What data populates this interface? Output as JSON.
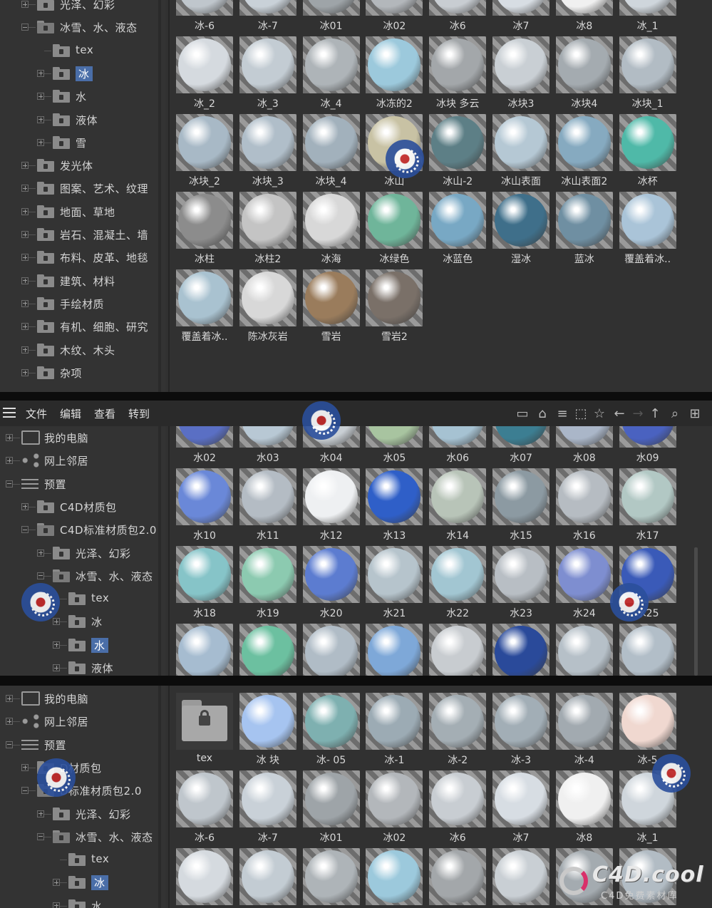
{
  "panel1": {
    "tree": [
      {
        "label": "光泽、幻彩",
        "icon": "folder-icon"
      },
      {
        "label": "冰雪、水、液态",
        "icon": "folder-open-icon"
      },
      {
        "label": "tex",
        "icon": "folder-icon"
      },
      {
        "label": "冰",
        "icon": "folder-icon",
        "selected": true
      },
      {
        "label": "水",
        "icon": "folder-icon"
      },
      {
        "label": "液体",
        "icon": "folder-icon"
      },
      {
        "label": "雪",
        "icon": "folder-icon"
      },
      {
        "label": "发光体",
        "icon": "folder-icon"
      },
      {
        "label": "图案、艺术、纹理",
        "icon": "folder-icon"
      },
      {
        "label": "地面、草地",
        "icon": "folder-icon"
      },
      {
        "label": "岩石、混凝土、墙",
        "icon": "folder-icon"
      },
      {
        "label": "布料、皮革、地毯",
        "icon": "folder-icon"
      },
      {
        "label": "建筑、材料",
        "icon": "folder-icon"
      },
      {
        "label": "手绘材质",
        "icon": "folder-icon"
      },
      {
        "label": "有机、细胞、研究",
        "icon": "folder-icon"
      },
      {
        "label": "木纹、木头",
        "icon": "folder-icon"
      },
      {
        "label": "杂项",
        "icon": "folder-icon"
      }
    ],
    "materials": [
      {
        "label": "冰-6",
        "color": "#bfc6cc"
      },
      {
        "label": "冰-7",
        "color": "#c9d1d8"
      },
      {
        "label": "冰01",
        "color": "#9ea4a8"
      },
      {
        "label": "冰02",
        "color": "#b3b7bb"
      },
      {
        "label": "冰6",
        "color": "#c8cdd2"
      },
      {
        "label": "冰7",
        "color": "#d7dde3"
      },
      {
        "label": "冰8",
        "color": "#f0f0f0"
      },
      {
        "label": "冰_1",
        "color": "#cfd6dc"
      },
      {
        "label": "冰_2",
        "color": "#d5dadf"
      },
      {
        "label": "冰_3",
        "color": "#c3ccd3"
      },
      {
        "label": "冰_4",
        "color": "#aeb4b8"
      },
      {
        "label": "冰冻的2",
        "color": "#9cc9dc"
      },
      {
        "label": "冰块 多云",
        "color": "#a3a7aa"
      },
      {
        "label": "冰块3",
        "color": "#c9cfd4"
      },
      {
        "label": "冰块4",
        "color": "#a4abb0"
      },
      {
        "label": "冰块_1",
        "color": "#b2bcc4"
      },
      {
        "label": "冰块_2",
        "color": "#a8b9c6"
      },
      {
        "label": "冰块_3",
        "color": "#b0bec9"
      },
      {
        "label": "冰块_4",
        "color": "#a2b1bc"
      },
      {
        "label": "冰山",
        "color": "#c8c2a4"
      },
      {
        "label": "冰山-2",
        "color": "#5d7f86"
      },
      {
        "label": "冰山表面",
        "color": "#b5c8d4"
      },
      {
        "label": "冰山表面2",
        "color": "#86aac0"
      },
      {
        "label": "冰杯",
        "color": "#4fb9a8"
      },
      {
        "label": "冰柱",
        "color": "#8c8c8c"
      },
      {
        "label": "冰柱2",
        "color": "#c4c4c4"
      },
      {
        "label": "冰海",
        "color": "#d8d8d8"
      },
      {
        "label": "冰绿色",
        "color": "#6fb59a"
      },
      {
        "label": "冰蓝色",
        "color": "#78a8c4"
      },
      {
        "label": "湿冰",
        "color": "#3f6f8a"
      },
      {
        "label": "蓝冰",
        "color": "#6f8fa2"
      },
      {
        "label": "覆盖着冰..",
        "color": "#aac4d8"
      },
      {
        "label": "覆盖着冰..",
        "color": "#a9c2d0"
      },
      {
        "label": "陈冰灰岩",
        "color": "#d8d8d8"
      },
      {
        "label": "雪岩",
        "color": "#9a7c5c"
      },
      {
        "label": "雪岩2",
        "color": "#7a7068"
      }
    ]
  },
  "panel2": {
    "menu": [
      "文件",
      "编辑",
      "查看",
      "转到"
    ],
    "tree": [
      {
        "label": "我的电脑",
        "icon": "computer-icon"
      },
      {
        "label": "网上邻居",
        "icon": "network-icon"
      },
      {
        "label": "预置",
        "icon": "presets-icon"
      },
      {
        "label": "C4D材质包",
        "icon": "folder-icon"
      },
      {
        "label": "C4D标准材质包2.0",
        "icon": "folder-open-icon"
      },
      {
        "label": "光泽、幻彩",
        "icon": "folder-icon"
      },
      {
        "label": "冰雪、水、液态",
        "icon": "folder-open-icon"
      },
      {
        "label": "tex",
        "icon": "folder-icon"
      },
      {
        "label": "冰",
        "icon": "folder-icon"
      },
      {
        "label": "水",
        "icon": "folder-icon",
        "selected": true
      },
      {
        "label": "液体",
        "icon": "folder-icon"
      }
    ],
    "materials": [
      {
        "label": "水02",
        "color": "#5a6fc4"
      },
      {
        "label": "水03",
        "color": "#b8c8d4"
      },
      {
        "label": "水04",
        "color": "#c9cfd4"
      },
      {
        "label": "水05",
        "color": "#a8c4a0"
      },
      {
        "label": "水06",
        "color": "#a6c2d2"
      },
      {
        "label": "水07",
        "color": "#3c7e92"
      },
      {
        "label": "水08",
        "color": "#aab6c8"
      },
      {
        "label": "水09",
        "color": "#4a62c0"
      },
      {
        "label": "水10",
        "color": "#6a88d8"
      },
      {
        "label": "水11",
        "color": "#b4bcc4"
      },
      {
        "label": "水12",
        "color": "#eef0f2"
      },
      {
        "label": "水13",
        "color": "#2f5fc8"
      },
      {
        "label": "水14",
        "color": "#b8c4b8"
      },
      {
        "label": "水15",
        "color": "#8c9aa2"
      },
      {
        "label": "水16",
        "color": "#b6bcc2"
      },
      {
        "label": "水17",
        "color": "#b2c8c4"
      },
      {
        "label": "水18",
        "color": "#86c4c8"
      },
      {
        "label": "水19",
        "color": "#8ccab0"
      },
      {
        "label": "水20",
        "color": "#5c7cd0"
      },
      {
        "label": "水21",
        "color": "#b6c4cc"
      },
      {
        "label": "水22",
        "color": "#a2c6d2"
      },
      {
        "label": "水23",
        "color": "#b8bec4"
      },
      {
        "label": "水24",
        "color": "#7e8ed0"
      },
      {
        "label": "水25",
        "color": "#3a5ab8"
      },
      {
        "label": "",
        "color": "#a6bcd0"
      },
      {
        "label": "",
        "color": "#6cc0a0"
      },
      {
        "label": "",
        "color": "#b0bcc6"
      },
      {
        "label": "",
        "color": "#7ea8d8"
      },
      {
        "label": "",
        "color": "#c8ccd0"
      },
      {
        "label": "",
        "color": "#2a4a9a"
      },
      {
        "label": "",
        "color": "#b6c0c8"
      },
      {
        "label": "",
        "color": "#b2bec8"
      }
    ]
  },
  "panel3": {
    "tree": [
      {
        "label": "我的电脑",
        "icon": "computer-icon"
      },
      {
        "label": "网上邻居",
        "icon": "network-icon"
      },
      {
        "label": "预置",
        "icon": "presets-icon"
      },
      {
        "label": "D材质包",
        "icon": "folder-icon"
      },
      {
        "label": "D标准材质包2.0",
        "icon": "folder-open-icon"
      },
      {
        "label": "光泽、幻彩",
        "icon": "folder-icon"
      },
      {
        "label": "冰雪、水、液态",
        "icon": "folder-open-icon"
      },
      {
        "label": "tex",
        "icon": "folder-icon"
      },
      {
        "label": "冰",
        "icon": "folder-icon",
        "selected": true
      },
      {
        "label": "水",
        "icon": "folder-icon"
      }
    ],
    "materials": [
      {
        "label": "tex",
        "color": "lock-folder"
      },
      {
        "label": "冰 块",
        "color": "#a6c4f0"
      },
      {
        "label": "冰- 05",
        "color": "#7eb0b0"
      },
      {
        "label": "冰-1",
        "color": "#9cabb4"
      },
      {
        "label": "冰-2",
        "color": "#a4aeb4"
      },
      {
        "label": "冰-3",
        "color": "#a2aeb6"
      },
      {
        "label": "冰-4",
        "color": "#a2aab0"
      },
      {
        "label": "冰-5",
        "color": "#f0d8d0"
      },
      {
        "label": "冰-6",
        "color": "#bfc6cc"
      },
      {
        "label": "冰-7",
        "color": "#c9d1d8"
      },
      {
        "label": "冰01",
        "color": "#9ea4a8"
      },
      {
        "label": "冰02",
        "color": "#b3b7bb"
      },
      {
        "label": "冰6",
        "color": "#c8cdd2"
      },
      {
        "label": "冰7",
        "color": "#d7dde3"
      },
      {
        "label": "冰8",
        "color": "#f0f0f0"
      },
      {
        "label": "冰_1",
        "color": "#cfd6dc"
      },
      {
        "label": "",
        "color": "#d5dadf"
      },
      {
        "label": "",
        "color": "#c3ccd3"
      },
      {
        "label": "",
        "color": "#aeb4b8"
      },
      {
        "label": "",
        "color": "#9cc9dc"
      },
      {
        "label": "",
        "color": "#a3a7aa"
      },
      {
        "label": "",
        "color": "#c9cfd4"
      },
      {
        "label": "",
        "color": "#a4abb0"
      },
      {
        "label": "",
        "color": "#b2bcc4"
      }
    ]
  },
  "watermark": {
    "title": "C4D.cool",
    "subtitle": "C4D免费素材库"
  }
}
